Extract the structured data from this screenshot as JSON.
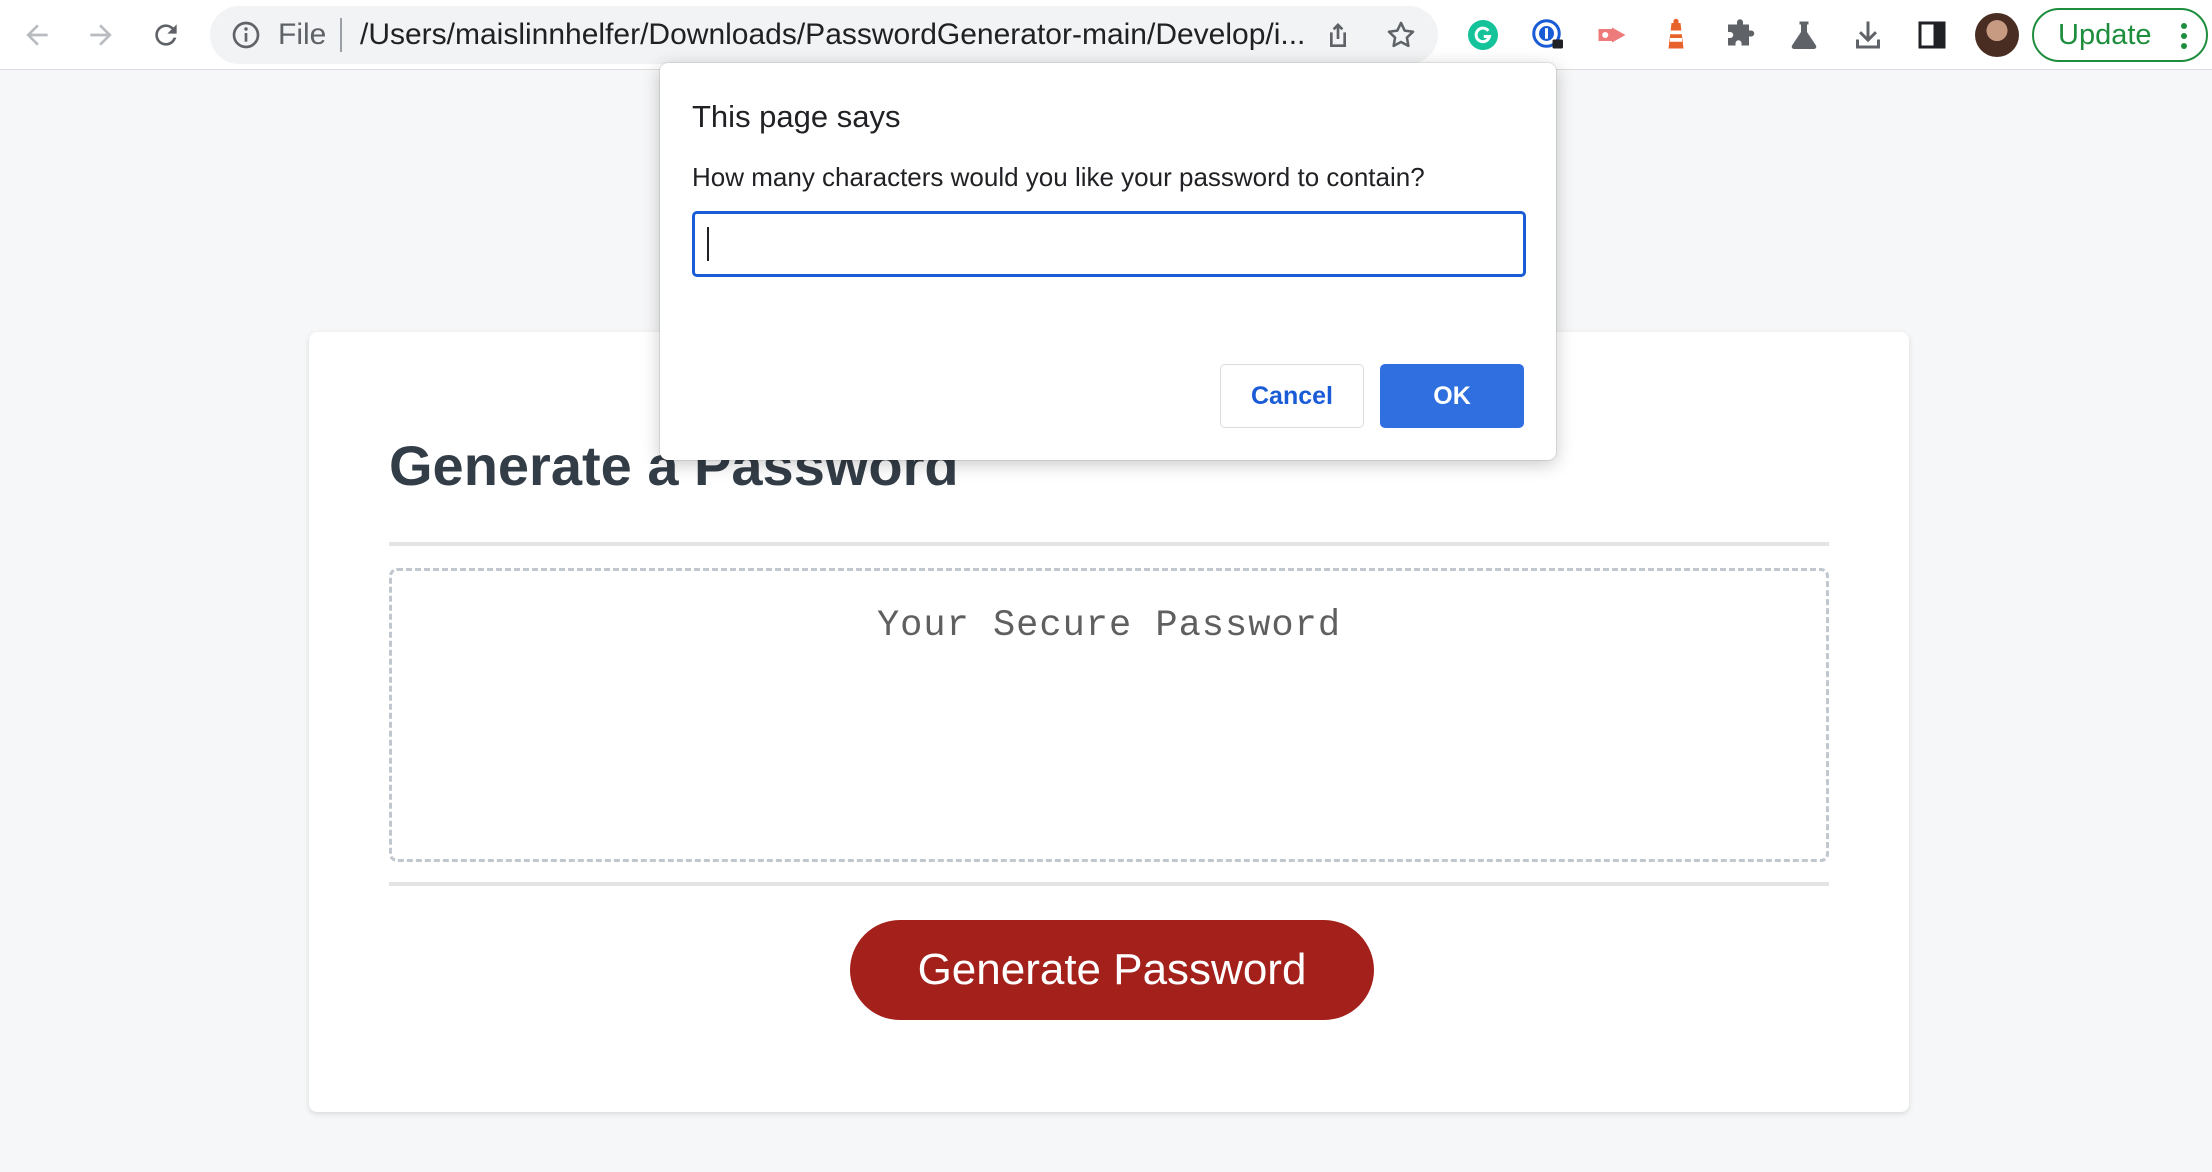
{
  "browser": {
    "omnibox": {
      "scheme_label": "File",
      "url": "/Users/maislinnhelfer/Downloads/PasswordGenerator-main/Develop/i..."
    },
    "icons": {
      "back": "back-arrow-icon",
      "forward": "forward-arrow-icon",
      "reload": "reload-icon",
      "info": "info-icon",
      "share": "share-icon",
      "bookmark": "star-icon",
      "extensions": [
        "grammarly-extension-icon",
        "password-manager-extension-icon",
        "screen-recorder-extension-icon",
        "lighthouse-extension-icon",
        "extensions-puzzle-icon",
        "labs-flask-icon",
        "downloads-icon",
        "side-panel-icon"
      ]
    },
    "update_label": "Update",
    "colors": {
      "update_accent": "#1e8e3e"
    }
  },
  "page": {
    "heading": "Generate a Password",
    "password_placeholder": "Your Secure Password",
    "generate_button_label": "Generate Password",
    "colors": {
      "button_bg": "#a3201b",
      "heading": "#333d47"
    }
  },
  "dialog": {
    "title": "This page says",
    "message": "How many characters would you like your password to contain?",
    "input_value": "",
    "cancel_label": "Cancel",
    "ok_label": "OK",
    "colors": {
      "primary": "#2f6fe0"
    }
  }
}
